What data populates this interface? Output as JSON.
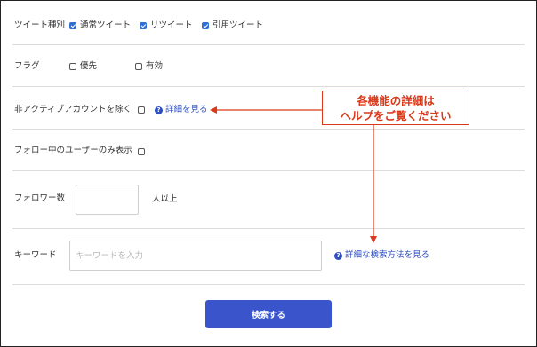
{
  "tweet_type": {
    "label": "ツイート種別",
    "options": [
      {
        "label": "通常ツイート",
        "checked": true
      },
      {
        "label": "リツイート",
        "checked": true
      },
      {
        "label": "引用ツイート",
        "checked": true
      }
    ]
  },
  "flag": {
    "label": "フラグ",
    "options": [
      {
        "label": "優先",
        "checked": false
      },
      {
        "label": "有効",
        "checked": false
      }
    ]
  },
  "exclude_inactive": {
    "label": "非アクティブアカウントを除く",
    "checked": false,
    "help_link": "詳細を見る"
  },
  "following_only": {
    "label": "フォロー中のユーザーのみ表示",
    "checked": false
  },
  "followers": {
    "label": "フォロワー数",
    "value": "",
    "suffix": "人以上"
  },
  "keyword": {
    "label": "キーワード",
    "value": "",
    "placeholder": "キーワードを入力",
    "help_link": "詳細な検索方法を見る"
  },
  "search_button": "検索する",
  "callout": {
    "line1": "各機能の詳細は",
    "line2": "ヘルプをご覧ください"
  },
  "colors": {
    "accent": "#3a55cc",
    "link": "#2f4fbf",
    "callout": "#d93a1b",
    "checkbox_checked": "#2f6fd6"
  }
}
